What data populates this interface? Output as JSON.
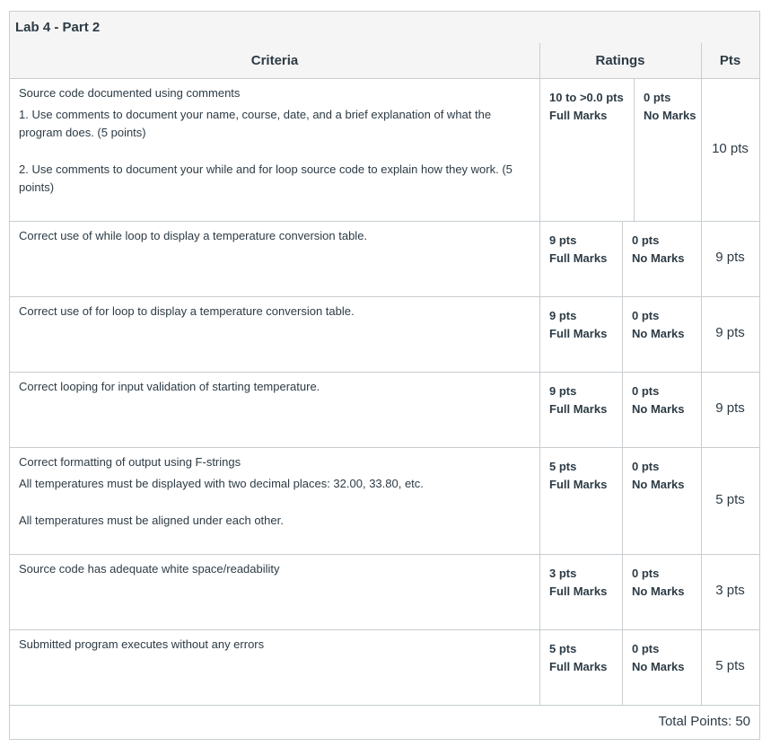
{
  "title": "Lab 4 - Part 2",
  "headers": {
    "criteria": "Criteria",
    "ratings": "Ratings",
    "pts": "Pts"
  },
  "rows": [
    {
      "criterion": "Source code documented using comments",
      "details": [
        "1. Use comments to document your name, course, date, and a brief explanation of what the program does. (5 points)",
        "2. Use comments to document your while and for loop source code to explain how they work. (5 points)"
      ],
      "full_pts": "10 to >0.0 pts",
      "full_desc": "Full Marks",
      "no_pts": "0 pts",
      "no_desc": "No Marks",
      "points": "10 pts"
    },
    {
      "criterion": "Correct use of while loop to display a temperature conversion table.",
      "details": [],
      "full_pts": "9 pts",
      "full_desc": "Full Marks",
      "no_pts": "0 pts",
      "no_desc": "No Marks",
      "points": "9 pts"
    },
    {
      "criterion": "Correct use of for loop to display a temperature conversion table.",
      "details": [],
      "full_pts": "9 pts",
      "full_desc": "Full Marks",
      "no_pts": "0 pts",
      "no_desc": "No Marks",
      "points": "9 pts"
    },
    {
      "criterion": "Correct looping for input validation of starting temperature.",
      "details": [],
      "full_pts": "9 pts",
      "full_desc": "Full Marks",
      "no_pts": "0 pts",
      "no_desc": "No Marks",
      "points": "9 pts"
    },
    {
      "criterion": "Correct formatting of output using F-strings",
      "details": [
        "All temperatures must be displayed with two decimal places: 32.00, 33.80, etc.",
        "All temperatures must be aligned under each other."
      ],
      "full_pts": "5 pts",
      "full_desc": "Full Marks",
      "no_pts": "0 pts",
      "no_desc": "No Marks",
      "points": "5 pts"
    },
    {
      "criterion": "Source code has adequate white space/readability",
      "details": [],
      "full_pts": "3 pts",
      "full_desc": "Full Marks",
      "no_pts": "0 pts",
      "no_desc": "No Marks",
      "points": "3 pts"
    },
    {
      "criterion": "Submitted program executes without any errors",
      "details": [],
      "full_pts": "5 pts",
      "full_desc": "Full Marks",
      "no_pts": "0 pts",
      "no_desc": "No Marks",
      "points": "5 pts"
    }
  ],
  "total": "Total Points: 50"
}
